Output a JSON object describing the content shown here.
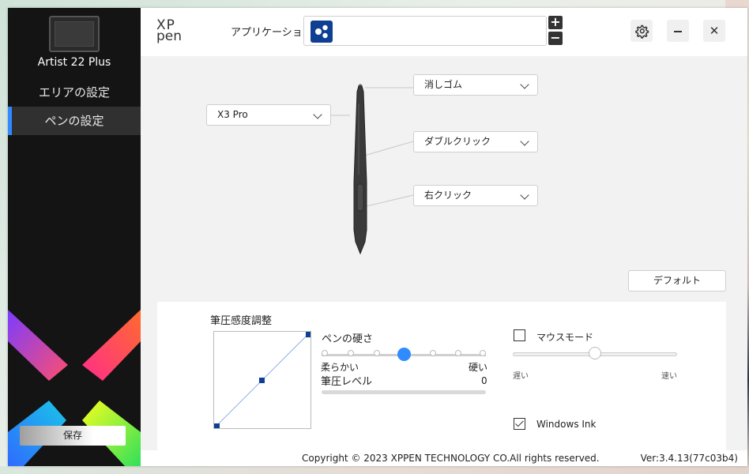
{
  "sidebar": {
    "device_name": "Artist 22 Plus",
    "nav": [
      {
        "label": "エリアの設定",
        "active": false
      },
      {
        "label": "ペンの設定",
        "active": true
      }
    ],
    "save_label": "保存",
    "accent_color": "#2f8bff"
  },
  "header": {
    "logo_text_top": "XP",
    "logo_text_bottom": "pen",
    "app_label": "アプリケーション:",
    "plus": "+",
    "minus": "−",
    "close": "✕",
    "icons": [
      "gear-icon",
      "minimize-icon",
      "close-icon"
    ]
  },
  "pen": {
    "model": "X3 Pro",
    "buttons": [
      {
        "name": "eraser",
        "value": "消しゴム"
      },
      {
        "name": "upper",
        "value": "ダブルクリック"
      },
      {
        "name": "lower",
        "value": "右クリック"
      }
    ],
    "default_label": "デフォルト"
  },
  "pressure": {
    "title": "筆圧感度調整",
    "hardness_label": "ペンの硬さ",
    "soft_label": "柔らかい",
    "hard_label": "硬い",
    "level_label": "筆圧レベル",
    "level_value": "0",
    "hardness_value": 0.5
  },
  "mouse": {
    "label": "マウスモード",
    "checked": false,
    "slow_label": "遅い",
    "fast_label": "速い",
    "speed_value": 0.5
  },
  "windows_ink": {
    "label": "Windows Ink",
    "checked": true
  },
  "footer": {
    "copyright": "Copyright © 2023  XPPEN TECHNOLOGY CO.All rights reserved.",
    "version": "Ver:3.4.13(77c03b4)"
  }
}
